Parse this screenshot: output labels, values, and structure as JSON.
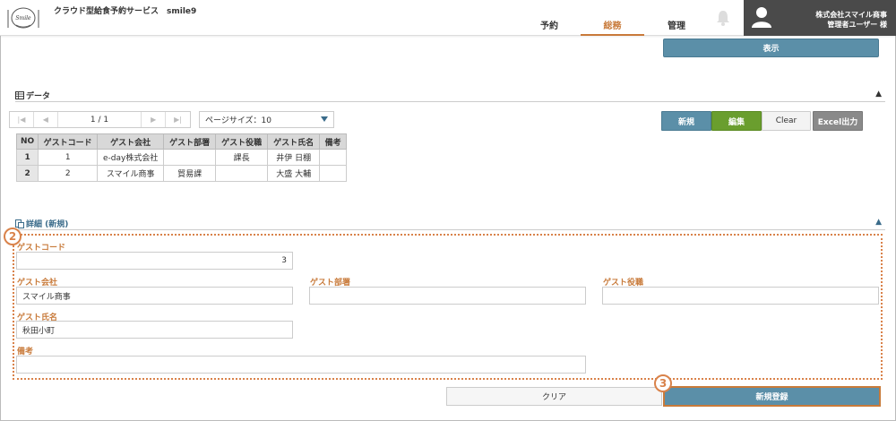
{
  "header": {
    "app_title": "クラウド型給食予約サービス　smile9",
    "logo_text": "Smile",
    "nav": [
      {
        "label": "予約"
      },
      {
        "label": "総務"
      },
      {
        "label": "管理"
      }
    ],
    "user": {
      "company": "株式会社スマイル商事",
      "name": "管理者ユーザー 様"
    }
  },
  "display_button": "表示",
  "data_section": {
    "title": "データ",
    "pager": {
      "info": "1 / 1"
    },
    "page_size": "ページサイズ：10",
    "buttons": {
      "new": "新規",
      "edit": "編集",
      "clear": "Clear",
      "excel": "Excel出力"
    },
    "columns": [
      "NO",
      "ゲストコード",
      "ゲスト会社",
      "ゲスト部署",
      "ゲスト役職",
      "ゲスト氏名",
      "備考"
    ],
    "rows": [
      [
        "1",
        "1",
        "e-day株式会社",
        "",
        "課長",
        "井伊 日棚",
        ""
      ],
      [
        "2",
        "2",
        "スマイル商事",
        "貿易課",
        "",
        "大盛 大輔",
        ""
      ]
    ]
  },
  "detail_section": {
    "title": "詳細 (新規)",
    "badge_form": "2",
    "badge_register": "3",
    "fields": {
      "guest_code": {
        "label": "ゲストコード",
        "value": "3"
      },
      "guest_company": {
        "label": "ゲスト会社",
        "value": "スマイル商事"
      },
      "guest_dept": {
        "label": "ゲスト部署",
        "value": ""
      },
      "guest_position": {
        "label": "ゲスト役職",
        "value": ""
      },
      "guest_name": {
        "label": "ゲスト氏名",
        "value": "秋田小町"
      },
      "remarks": {
        "label": "備考",
        "value": ""
      }
    },
    "buttons": {
      "reset": "クリア",
      "register": "新規登録"
    }
  },
  "colors": {
    "accent_blue": "#5b8fa8",
    "accent_orange": "#c87a3a",
    "edit_green": "#6a9e2e"
  }
}
